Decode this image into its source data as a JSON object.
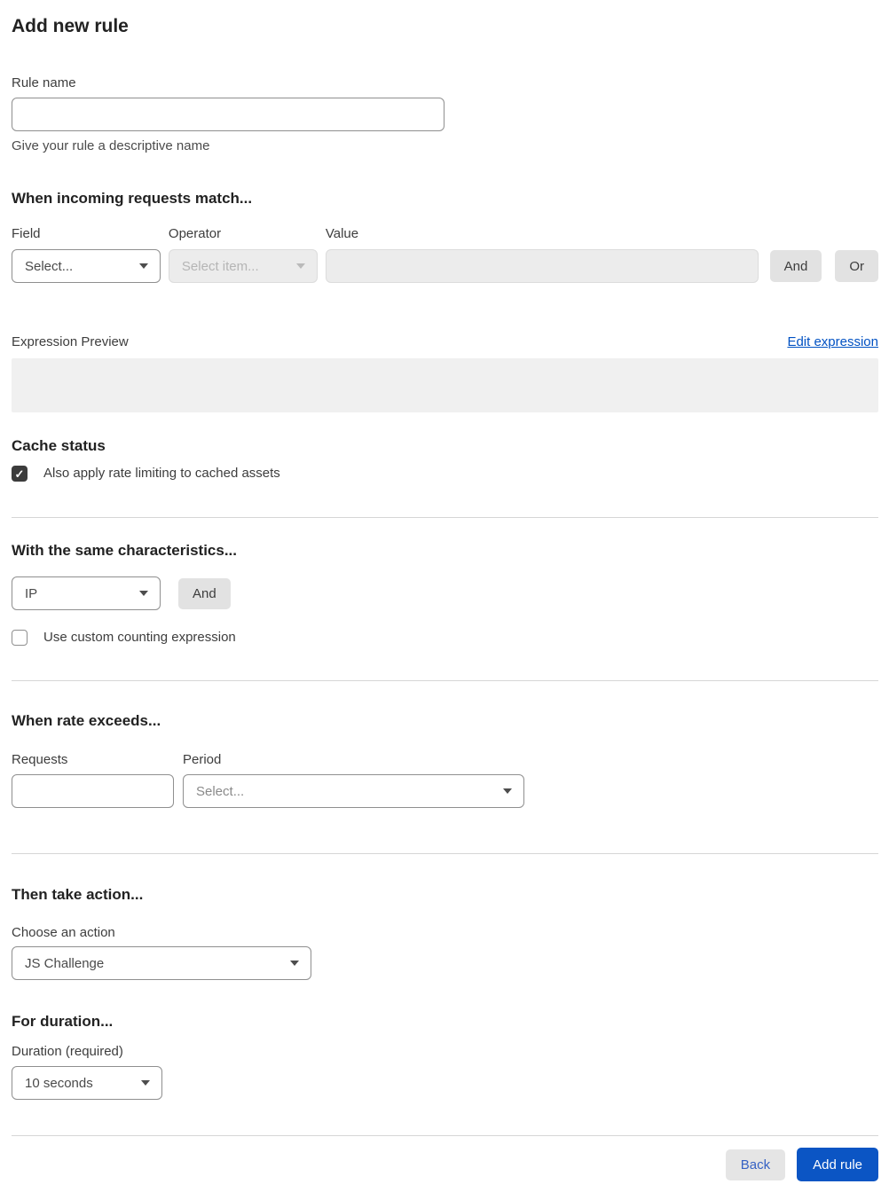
{
  "page": {
    "title": "Add new rule"
  },
  "colors": {
    "accent_blue": "#0b55c4",
    "link_blue": "#0051c3",
    "checkbox_dark": "#3c3c3c",
    "disabled_bg": "#ececec",
    "preview_bg": "#f0f0f0"
  },
  "rule_name": {
    "label": "Rule name",
    "value": "",
    "help": "Give your rule a descriptive name"
  },
  "match_section": {
    "heading": "When incoming requests match...",
    "field": {
      "label": "Field",
      "selected": "Select..."
    },
    "operator": {
      "label": "Operator",
      "selected": "Select item...",
      "disabled": true
    },
    "value": {
      "label": "Value",
      "value": "",
      "disabled": true
    },
    "and_button": "And",
    "or_button": "Or",
    "expression_preview_label": "Expression Preview",
    "edit_expression_link": "Edit expression",
    "expression_preview_value": ""
  },
  "cache_section": {
    "heading": "Cache status",
    "checkbox_label": "Also apply rate limiting to cached assets",
    "checked": true
  },
  "characteristics_section": {
    "heading": "With the same characteristics...",
    "characteristic": {
      "selected": "IP"
    },
    "and_button": "And",
    "custom_counting": {
      "label": "Use custom counting expression",
      "checked": false
    }
  },
  "rate_section": {
    "heading": "When rate exceeds...",
    "requests": {
      "label": "Requests",
      "value": ""
    },
    "period": {
      "label": "Period",
      "selected": "Select..."
    }
  },
  "action_section": {
    "heading": "Then take action...",
    "choose_label": "Choose an action",
    "action": {
      "selected": "JS Challenge"
    }
  },
  "duration_section": {
    "heading": "For duration...",
    "duration_label": "Duration (required)",
    "duration": {
      "selected": "10 seconds"
    }
  },
  "footer": {
    "back_label": "Back",
    "add_rule_label": "Add rule"
  }
}
